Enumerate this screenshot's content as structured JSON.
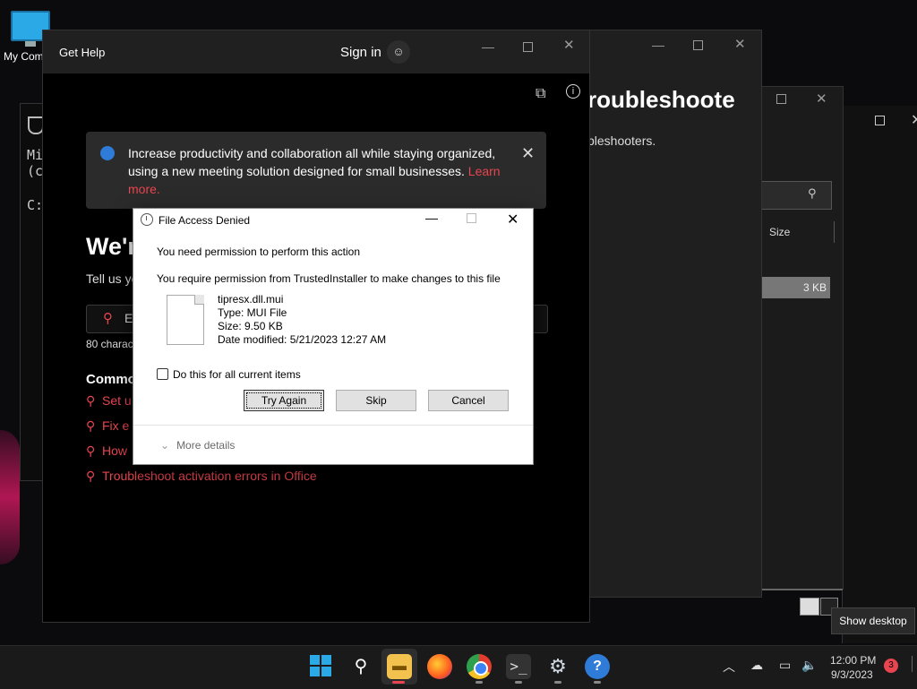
{
  "desktop": {
    "icon_label": "My Com"
  },
  "cmd": {
    "line1": "Mi",
    "line2": "(c",
    "line3": "C:"
  },
  "troubleshooter": {
    "title": "roubleshoote",
    "subtitle": "bleshooters."
  },
  "explorer": {
    "size_header": "Size",
    "size_value": "3 KB"
  },
  "get_help": {
    "title": "Get Help",
    "sign_in": "Sign in",
    "banner_text": "Increase productivity and collaboration all while staying organized, using a new meeting solution designed for small businesses.",
    "banner_link": "Learn more.",
    "heading": "We'r",
    "tell_us": "Tell us yo",
    "search_prefix": "E",
    "char_count": "80 charac",
    "common_heading": "Commo",
    "links": [
      "Set u",
      "Fix e",
      "How",
      "Troubleshoot activation errors in Office"
    ]
  },
  "dialog": {
    "title": "File Access Denied",
    "permission_text": "You need permission to perform this action",
    "trusted_text": "You require permission from TrustedInstaller to make changes to this file",
    "file_name": "tipresx.dll.mui",
    "file_type": "Type: MUI File",
    "file_size": "Size: 9.50 KB",
    "file_date": "Date modified: 5/21/2023 12:27 AM",
    "checkbox_label": "Do this for all current items",
    "btn_try": "Try Again",
    "btn_skip": "Skip",
    "btn_cancel": "Cancel",
    "more_details": "More details"
  },
  "taskbar": {
    "show_desktop": "Show desktop",
    "time": "12:00 PM",
    "date": "9/3/2023",
    "notification_count": "3",
    "colors": {
      "accent": "#e84550",
      "windows_blue": "#2aa9e6"
    }
  }
}
